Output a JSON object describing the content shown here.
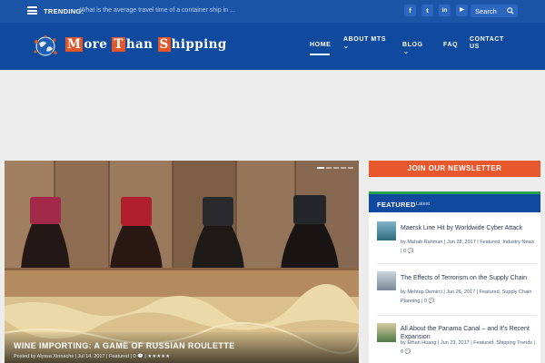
{
  "topbar": {
    "trending_label": "TRENDING:",
    "trending_text": "What is the average travel time of a container ship in ...",
    "social": [
      {
        "icon": "facebook-icon",
        "glyph": "f"
      },
      {
        "icon": "twitter-icon",
        "glyph": "t"
      },
      {
        "icon": "linkedin-icon",
        "glyph": "in"
      },
      {
        "icon": "youtube-icon",
        "glyph": "▶"
      }
    ],
    "search_label": "Search"
  },
  "header": {
    "logo": {
      "m": "M",
      "m_rest": "ore ",
      "t": "T",
      "t_rest": "han ",
      "s": "S",
      "s_rest": "hipping"
    },
    "nav": {
      "home": "HOME",
      "about_line1": "ABOUT MTS",
      "about_arrow": "⌄",
      "blog": "BLOG",
      "blog_arrow": "⌄",
      "faq": "FAQ",
      "contact_line1": "CONTACT",
      "contact_line2": "US"
    }
  },
  "slider": {
    "title": "WINE IMPORTING: A GAME OF RUSSIAN ROULETTE",
    "meta": "Posted by Alyssa Xinnachs | Jul 14, 2017 | Featured | 0 💬 | ★★★★★",
    "dot_count": 5
  },
  "sidebar": {
    "newsletter": "JOIN OUR NEWSLETTER",
    "widget_title": "FEATURED",
    "widget_sub": "Latest",
    "posts": [
      {
        "title": "Maersk Line Hit by Worldwide Cyber Attack",
        "meta": "by Mahab Rahman | Jun 28, 2017 | Featured, Industry News | 0 💬"
      },
      {
        "title": "The Effects of Terrorism on the Supply Chain",
        "meta": "by Mehtap Demirci | Jun 26, 2017 | Featured, Supply Chain Planning | 0 💬"
      },
      {
        "title": "All About the Panama Canal – and It's Recent Expansion",
        "meta": "by Ethan Huang | Jun 23, 2017 | Featured, Shipping Trends | 0 💬"
      }
    ]
  },
  "colors": {
    "topbar": "#1b55a8",
    "header": "#0f4a9e",
    "accent_orange": "#e9582c",
    "accent_green": "#25a24c",
    "page_bg": "#ececec"
  }
}
